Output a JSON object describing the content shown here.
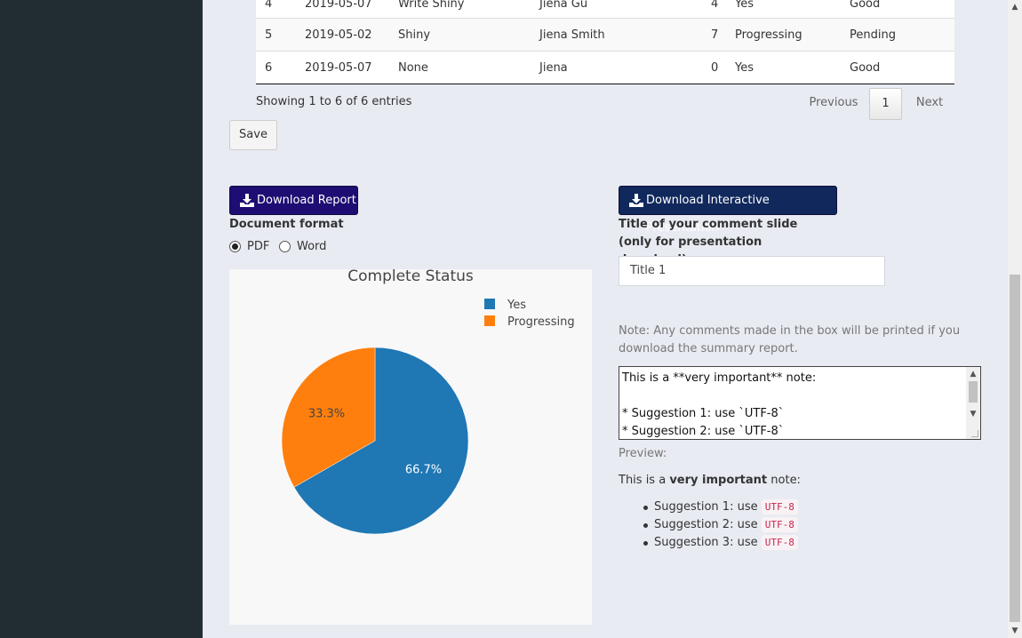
{
  "table": {
    "rows": [
      {
        "no": "4",
        "date": "2019-05-07",
        "task": "Write Shiny",
        "owner": "Jiena Gu",
        "count": "4",
        "status": "Yes",
        "result": "Good"
      },
      {
        "no": "5",
        "date": "2019-05-02",
        "task": "Shiny",
        "owner": "Jiena Smith",
        "count": "7",
        "status": "Progressing",
        "result": "Pending"
      },
      {
        "no": "6",
        "date": "2019-05-07",
        "task": "None",
        "owner": "Jiena",
        "count": "0",
        "status": "Yes",
        "result": "Good"
      }
    ],
    "info": "Showing 1 to 6 of 6 entries",
    "pagination": {
      "previous": "Previous",
      "page": "1",
      "next": "Next"
    }
  },
  "save_label": "Save",
  "report": {
    "download_label": "Download Report",
    "format_label": "Document format",
    "formats": [
      {
        "label": "PDF",
        "selected": true
      },
      {
        "label": "Word",
        "selected": false
      }
    ]
  },
  "presentation": {
    "download_label": "Download Interactive Presentation",
    "title_label": "Title of your comment slide (only for presentation download):",
    "title_value": "Title 1"
  },
  "note": "Note: Any comments made in the box will be printed if you download the summary report.",
  "comment_lines": [
    "This is a **very important** note:",
    "",
    "* Suggestion 1: use `UTF-8`",
    "* Suggestion 2: use `UTF-8`"
  ],
  "preview": {
    "label": "Preview:",
    "intro_before": "This is a ",
    "intro_bold": "very important",
    "intro_after": " note:",
    "suggestions": [
      {
        "text": "Suggestion 1: use ",
        "code": "UTF-8"
      },
      {
        "text": "Suggestion 2: use ",
        "code": "UTF-8"
      },
      {
        "text": "Suggestion 3: use ",
        "code": "UTF-8"
      }
    ]
  },
  "colors": {
    "yes": "#1f77b4",
    "progressing": "#ff7f0e",
    "report_button": "#1e0d73",
    "presentation_button": "#11285c"
  },
  "chart_data": {
    "type": "pie",
    "title": "Complete Status",
    "labels": [
      "Yes",
      "Progressing"
    ],
    "values": [
      66.7,
      33.3
    ],
    "value_labels": [
      "66.7%",
      "33.3%"
    ],
    "legend_position": "top-right"
  }
}
